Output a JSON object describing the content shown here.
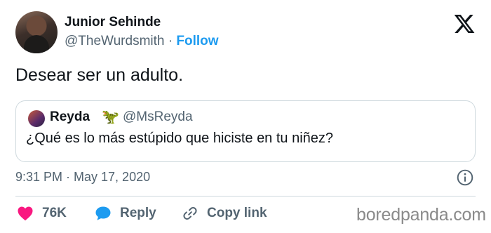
{
  "author": {
    "name": "Junior Sehinde",
    "handle": "@TheWurdsmith",
    "separator": "·",
    "follow_label": "Follow"
  },
  "tweet": {
    "text": "Desear ser un adulto."
  },
  "quoted_tweet": {
    "name": "Reyda",
    "emoji": "🦖",
    "handle": "@MsReyda",
    "text": "¿Qué es lo más estúpido que hiciste en tu niñez?"
  },
  "meta": {
    "timestamp": "9:31 PM · May 17, 2020"
  },
  "actions": {
    "likes_count": "76K",
    "reply_label": "Reply",
    "copy_link_label": "Copy link"
  },
  "watermark": "boredpanda.com",
  "icons": {
    "brand": "x-logo-icon",
    "info": "info-icon",
    "like": "heart-icon",
    "reply": "speech-bubble-icon",
    "copy": "link-icon"
  },
  "colors": {
    "accent": "#1d9bf0",
    "like": "#f91880",
    "secondary_text": "#536471",
    "border": "#cfd9de"
  }
}
